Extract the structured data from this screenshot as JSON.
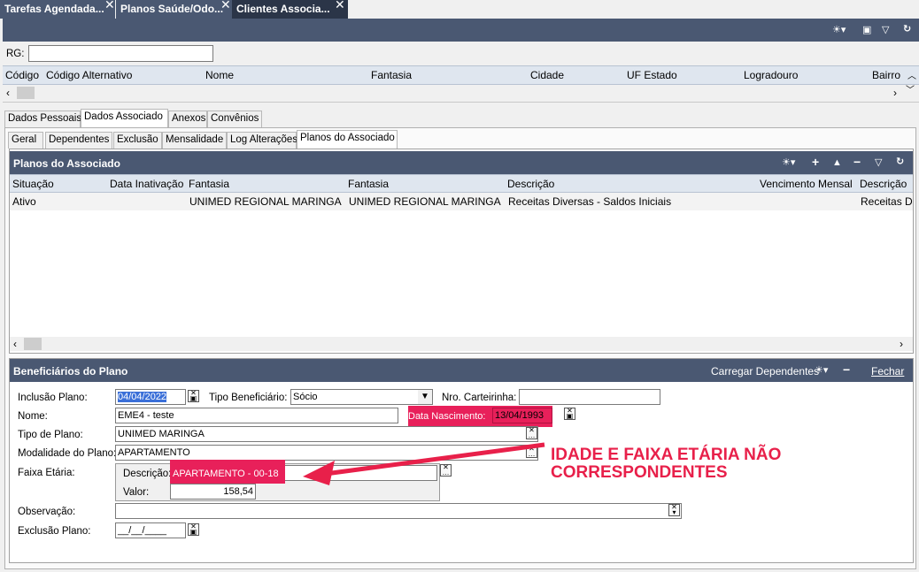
{
  "doc_tabs": [
    {
      "label": "Tarefas Agendada..."
    },
    {
      "label": "Planos Saúde/Odo..."
    },
    {
      "label": "Clientes Associa..."
    }
  ],
  "search": {
    "label": "RG:",
    "value": ""
  },
  "main_grid": {
    "columns": [
      "Código",
      "Código Alternativo",
      "Nome",
      "Fantasia",
      "Cidade",
      "UF Estado",
      "Logradouro",
      "Bairro"
    ]
  },
  "tabs": [
    "Dados Pessoais",
    "Dados Associado",
    "Anexos",
    "Convênios"
  ],
  "subtabs": [
    "Geral",
    "Dependentes",
    "Exclusão",
    "Mensalidade",
    "Log Alterações",
    "Planos do Associado"
  ],
  "planos": {
    "title": "Planos do Associado",
    "columns": [
      "Situação",
      "Data Inativação",
      "Fantasia",
      "Fantasia",
      "Descrição",
      "Vencimento Mensal",
      "Descrição"
    ],
    "row": {
      "situacao": "Ativo",
      "fantasia1": "UNIMED REGIONAL MARINGA",
      "fantasia2": "UNIMED REGIONAL MARINGA",
      "descricao": "Receitas Diversas - Saldos Iniciais",
      "descricao2": "Receitas D"
    }
  },
  "benef": {
    "title": "Beneficiários do Plano",
    "carregar": "Carregar Dependentes",
    "fechar": "Fechar",
    "inclusao_label": "Inclusão Plano:",
    "inclusao_value": "04/04/2022",
    "tipo_benef_label": "Tipo Beneficiário:",
    "tipo_benef_value": "Sócio",
    "carteirinha_label": "Nro. Carteirinha:",
    "carteirinha_value": "",
    "nome_label": "Nome:",
    "nome_value": "EME4 - teste",
    "nasc_label": "Data Nascimento:",
    "nasc_value": "13/04/1993",
    "tipo_plano_label": "Tipo de Plano:",
    "tipo_plano_value": "UNIMED MARINGA",
    "modalidade_label": "Modalidade do Plano:",
    "modalidade_value": "APARTAMENTO",
    "faixa_label": "Faixa Etária:",
    "faixa_desc_label": "Descrição:",
    "faixa_desc_value": "APARTAMENTO - 00-18",
    "faixa_valor_label": "Valor:",
    "faixa_valor_value": "158,54",
    "obs_label": "Observação:",
    "obs_value": "",
    "exclusao_label": "Exclusão Plano:",
    "exclusao_value": "__/__/____"
  },
  "annotation": {
    "line1": "IDADE E FAIXA ETÁRIA NÃO",
    "line2": "CORRESPONDENTES"
  },
  "colors": {
    "toolbar": "#4a5872",
    "doc_tab": "#4a5872",
    "doc_tab_active": "#2b3548",
    "grid_head": "#dfe6ef",
    "highlight": "#e8205a",
    "annotation": "#e8204a"
  }
}
